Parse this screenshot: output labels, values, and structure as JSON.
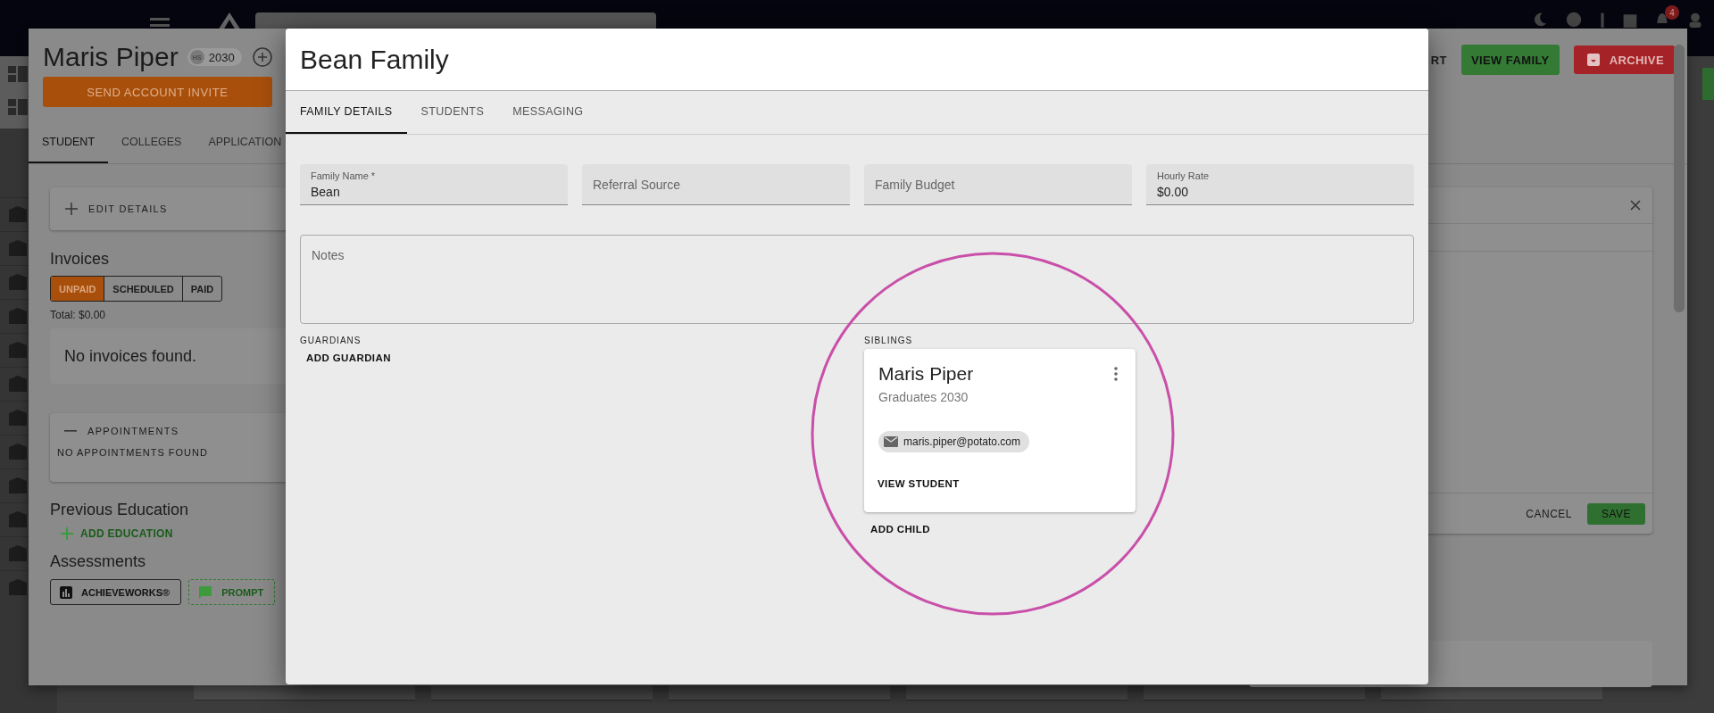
{
  "topbar": {
    "notification_count": "4"
  },
  "student": {
    "name": "Maris Piper",
    "chip_abbr": "HS",
    "chip_year": "2030",
    "invite_button": "SEND ACCOUNT INVITE",
    "tabs": [
      {
        "label": "STUDENT",
        "selected": true
      },
      {
        "label": "COLLEGES",
        "selected": false
      },
      {
        "label": "APPLICATION",
        "selected": false
      }
    ],
    "actions": [
      {
        "label": "RT",
        "kind": "text"
      },
      {
        "label": "VIEW FAMILY",
        "kind": "success"
      },
      {
        "label": "ARCHIVE",
        "kind": "danger"
      }
    ],
    "edit_details": "EDIT DETAILS",
    "invoices": {
      "title": "Invoices",
      "filters": [
        {
          "label": "UNPAID",
          "selected": true
        },
        {
          "label": "SCHEDULED",
          "selected": false
        },
        {
          "label": "PAID",
          "selected": false
        }
      ],
      "total": "Total: $0.00",
      "empty": "No invoices found."
    },
    "appointments": {
      "title": "APPOINTMENTS",
      "empty": "NO APPOINTMENTS FOUND"
    },
    "previous_education": {
      "title": "Previous Education",
      "add": "ADD EDUCATION"
    },
    "assessments": {
      "title": "Assessments",
      "buttons": [
        {
          "label": "ACHIEVEWORKS®",
          "kind": "outlined"
        },
        {
          "label": "PROMPT",
          "kind": "success"
        }
      ]
    },
    "side_panel": {
      "cancel": "CANCEL",
      "save": "SAVE"
    }
  },
  "dialog": {
    "title": "Bean Family",
    "tabs": [
      {
        "label": "FAMILY DETAILS",
        "selected": true
      },
      {
        "label": "STUDENTS",
        "selected": false
      },
      {
        "label": "MESSAGING",
        "selected": false
      }
    ],
    "fields": [
      {
        "label": "Family Name *",
        "value": "Bean"
      },
      {
        "placeholder": "Referral Source"
      },
      {
        "placeholder": "Family Budget"
      },
      {
        "label": "Hourly Rate",
        "value": "$0.00"
      }
    ],
    "notes": {
      "placeholder": "Notes"
    },
    "guardians": {
      "title": "GUARDIANS",
      "add": "ADD GUARDIAN"
    },
    "siblings": {
      "title": "SIBLINGS",
      "cards": [
        {
          "name": "Maris Piper",
          "subtitle": "Graduates 2030",
          "email": "maris.piper@potato.com",
          "action": "VIEW STUDENT"
        }
      ],
      "add": "ADD CHILD"
    }
  }
}
